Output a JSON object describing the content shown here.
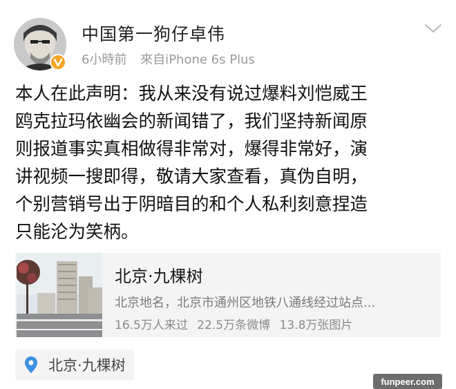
{
  "header": {
    "username": "中国第一狗仔卓伟",
    "time": "6小時前",
    "source": "來自iPhone 6s Plus"
  },
  "content": {
    "lines": [
      "本人在此声明：我从来没有说过爆料刘恺威王",
      "鸥克拉玛依幽会的新闻错了，我们坚持新闻原",
      "则报道事实真相做得非常对，爆得非常好，演",
      "讲视频一搜即得，敬请大家查看，真伪自明，",
      "个别营销号出于阴暗目的和个人私利刻意捏造",
      "只能沦为笑柄。"
    ]
  },
  "location_card": {
    "title": "北京·九棵树",
    "description": "北京地名，北京市通州区地铁八通线经过站点...",
    "stats": [
      "16.5万人来过",
      "22.5万条微博",
      "13.8万张图片"
    ]
  },
  "location_tag": {
    "label": "北京·九棵树"
  },
  "watermark": "funpeer.com",
  "icons": {
    "verify": "verified-badge-icon",
    "menu": "chevron-down-icon",
    "location": "location-pin-icon"
  },
  "colors": {
    "badge": "#f6a623",
    "pin": "#3b8fe0",
    "meta_text": "#9a9a9a",
    "card_bg": "#f4f4f4"
  }
}
